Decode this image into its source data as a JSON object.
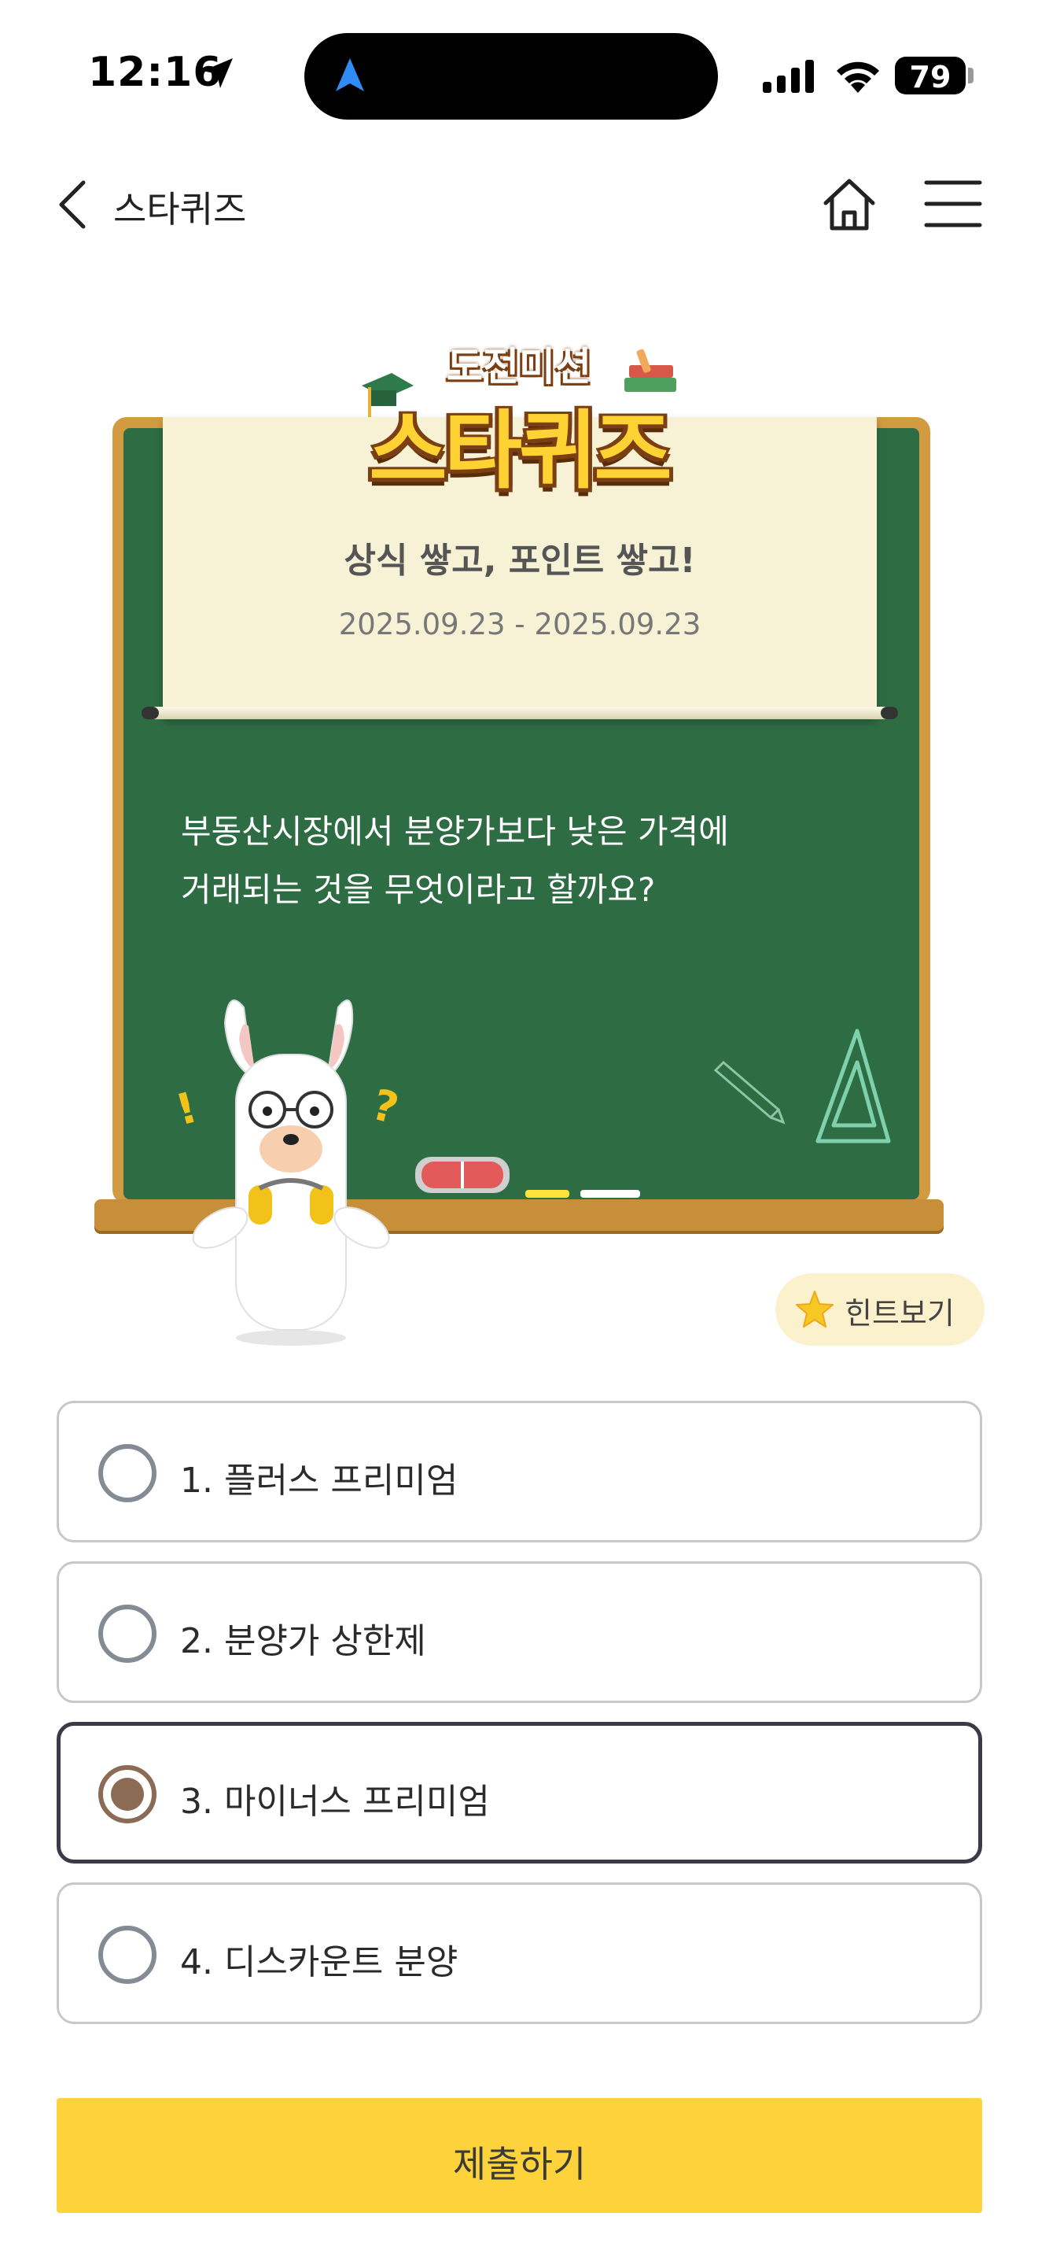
{
  "status_bar": {
    "time": "12:16",
    "battery": "79"
  },
  "navbar": {
    "title": "스타퀴즈"
  },
  "quiz": {
    "logo_top": "도전미션",
    "logo_main": "스타퀴즈",
    "subtitle": "상식 쌓고, 포인트 쌓고!",
    "period": "2025.09.23 - 2025.09.23",
    "question_line1": "부동산시장에서 분양가보다 낮은 가격에",
    "question_line2": "거래되는 것을 무엇이라고 할까요?",
    "hint_label": "힌트보기"
  },
  "options": [
    {
      "label": "1. 플러스 프리미엄",
      "selected": false
    },
    {
      "label": "2. 분양가 상한제",
      "selected": false
    },
    {
      "label": "3. 마이너스 프리미엄",
      "selected": true
    },
    {
      "label": "4. 디스카운트 분양",
      "selected": false
    }
  ],
  "submit_label": "제출하기",
  "colors": {
    "accent_yellow": "#fdd23a",
    "board_green": "#2e6d44",
    "board_wood": "#d39b41",
    "selected_radio": "#8b6b53"
  }
}
